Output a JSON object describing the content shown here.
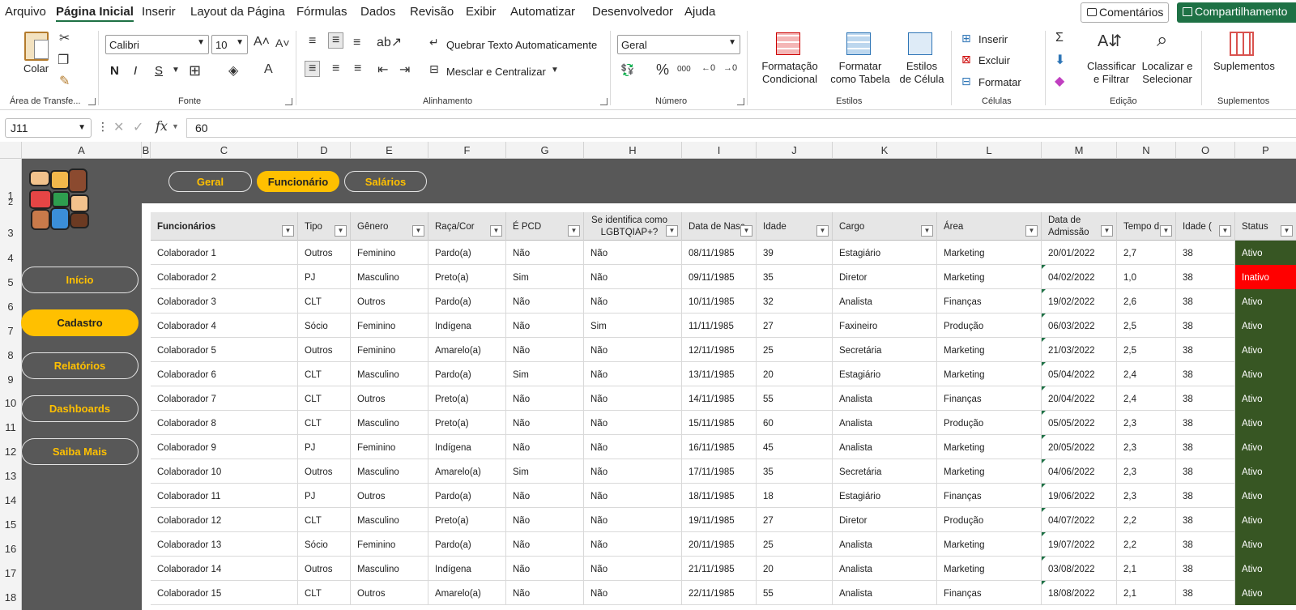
{
  "menu": {
    "items": [
      "Arquivo",
      "Página Inicial",
      "Inserir",
      "Layout da Página",
      "Fórmulas",
      "Dados",
      "Revisão",
      "Exibir",
      "Automatizar",
      "Desenvolvedor",
      "Ajuda"
    ],
    "active": "Página Inicial",
    "comments": "Comentários",
    "share": "Compartilhamento"
  },
  "ribbon": {
    "clipboard": {
      "paste": "Colar",
      "label": "Área de Transfe..."
    },
    "font": {
      "name": "Calibri",
      "size": "10",
      "bold": "N",
      "italic": "I",
      "underline": "S",
      "label": "Fonte"
    },
    "alignment": {
      "wrap": "Quebrar Texto Automaticamente",
      "merge": "Mesclar e Centralizar",
      "label": "Alinhamento"
    },
    "number": {
      "format": "Geral",
      "label": "Número"
    },
    "styles": {
      "cond": "Formatação Condicional",
      "table": "Formatar como Tabela",
      "cell": "Estilos de Célula",
      "label": "Estilos"
    },
    "cells": {
      "insert": "Inserir",
      "delete": "Excluir",
      "format": "Formatar",
      "label": "Células"
    },
    "editing": {
      "sort": "Classificar e Filtrar",
      "find": "Localizar e Selecionar",
      "label": "Edição"
    },
    "addins": {
      "btn": "Suplementos",
      "label": "Suplementos"
    }
  },
  "formula": {
    "cell": "J11",
    "value": "60"
  },
  "columns": [
    "A",
    "B",
    "C",
    "D",
    "E",
    "F",
    "G",
    "H",
    "I",
    "J",
    "K",
    "L",
    "M",
    "N",
    "O",
    "P"
  ],
  "rows": [
    "1",
    "2",
    "3",
    "4",
    "5",
    "6",
    "7",
    "8",
    "9",
    "10",
    "11",
    "12",
    "13",
    "14",
    "15",
    "16",
    "17",
    "18"
  ],
  "tabs": [
    "Geral",
    "Funcionário",
    "Salários"
  ],
  "tab_active": "Funcionário",
  "nav": [
    "Início",
    "Cadastro",
    "Relatórios",
    "Dashboards",
    "Saiba Mais"
  ],
  "nav_active": "Cadastro",
  "headers": [
    "Funcionários",
    "Tipo",
    "Gênero",
    "Raça/Cor",
    "É PCD",
    "Se identifica como LGBTQIAP+?",
    "Data de Nasc",
    "Idade",
    "Cargo",
    "Área",
    "Data de Admissão",
    "Tempo d",
    "Idade (",
    "Status"
  ],
  "table": [
    [
      "Colaborador 1",
      "Outros",
      "Feminino",
      "Pardo(a)",
      "Não",
      "Não",
      "08/11/1985",
      "39",
      "Estagiário",
      "Marketing",
      "20/01/2022",
      "2,7",
      "38",
      "Ativo"
    ],
    [
      "Colaborador 2",
      "PJ",
      "Masculino",
      "Preto(a)",
      "Sim",
      "Não",
      "09/11/1985",
      "35",
      "Diretor",
      "Marketing",
      "04/02/2022",
      "1,0",
      "38",
      "Inativo"
    ],
    [
      "Colaborador 3",
      "CLT",
      "Outros",
      "Pardo(a)",
      "Não",
      "Não",
      "10/11/1985",
      "32",
      "Analista",
      "Finanças",
      "19/02/2022",
      "2,6",
      "38",
      "Ativo"
    ],
    [
      "Colaborador 4",
      "Sócio",
      "Feminino",
      "Indígena",
      "Não",
      "Sim",
      "11/11/1985",
      "27",
      "Faxineiro",
      "Produção",
      "06/03/2022",
      "2,5",
      "38",
      "Ativo"
    ],
    [
      "Colaborador 5",
      "Outros",
      "Feminino",
      "Amarelo(a)",
      "Não",
      "Não",
      "12/11/1985",
      "25",
      "Secretária",
      "Marketing",
      "21/03/2022",
      "2,5",
      "38",
      "Ativo"
    ],
    [
      "Colaborador 6",
      "CLT",
      "Masculino",
      "Pardo(a)",
      "Sim",
      "Não",
      "13/11/1985",
      "20",
      "Estagiário",
      "Marketing",
      "05/04/2022",
      "2,4",
      "38",
      "Ativo"
    ],
    [
      "Colaborador 7",
      "CLT",
      "Outros",
      "Preto(a)",
      "Não",
      "Não",
      "14/11/1985",
      "55",
      "Analista",
      "Finanças",
      "20/04/2022",
      "2,4",
      "38",
      "Ativo"
    ],
    [
      "Colaborador 8",
      "CLT",
      "Masculino",
      "Preto(a)",
      "Não",
      "Não",
      "15/11/1985",
      "60",
      "Analista",
      "Produção",
      "05/05/2022",
      "2,3",
      "38",
      "Ativo"
    ],
    [
      "Colaborador 9",
      "PJ",
      "Feminino",
      "Indígena",
      "Não",
      "Não",
      "16/11/1985",
      "45",
      "Analista",
      "Marketing",
      "20/05/2022",
      "2,3",
      "38",
      "Ativo"
    ],
    [
      "Colaborador 10",
      "Outros",
      "Masculino",
      "Amarelo(a)",
      "Sim",
      "Não",
      "17/11/1985",
      "35",
      "Secretária",
      "Marketing",
      "04/06/2022",
      "2,3",
      "38",
      "Ativo"
    ],
    [
      "Colaborador 11",
      "PJ",
      "Outros",
      "Pardo(a)",
      "Não",
      "Não",
      "18/11/1985",
      "18",
      "Estagiário",
      "Finanças",
      "19/06/2022",
      "2,3",
      "38",
      "Ativo"
    ],
    [
      "Colaborador 12",
      "CLT",
      "Masculino",
      "Preto(a)",
      "Não",
      "Não",
      "19/11/1985",
      "27",
      "Diretor",
      "Produção",
      "04/07/2022",
      "2,2",
      "38",
      "Ativo"
    ],
    [
      "Colaborador 13",
      "Sócio",
      "Feminino",
      "Pardo(a)",
      "Não",
      "Não",
      "20/11/1985",
      "25",
      "Analista",
      "Marketing",
      "19/07/2022",
      "2,2",
      "38",
      "Ativo"
    ],
    [
      "Colaborador 14",
      "Outros",
      "Masculino",
      "Indígena",
      "Não",
      "Não",
      "21/11/1985",
      "20",
      "Analista",
      "Marketing",
      "03/08/2022",
      "2,1",
      "38",
      "Ativo"
    ],
    [
      "Colaborador 15",
      "CLT",
      "Outros",
      "Amarelo(a)",
      "Não",
      "Não",
      "22/11/1985",
      "55",
      "Analista",
      "Finanças",
      "18/08/2022",
      "2,1",
      "38",
      "Ativo"
    ]
  ],
  "colors": {
    "accent": "#1e7145",
    "nav_yellow": "#ffc000",
    "dark_bg": "#585858",
    "status_active": "#375623",
    "status_inactive": "#ff0000"
  }
}
